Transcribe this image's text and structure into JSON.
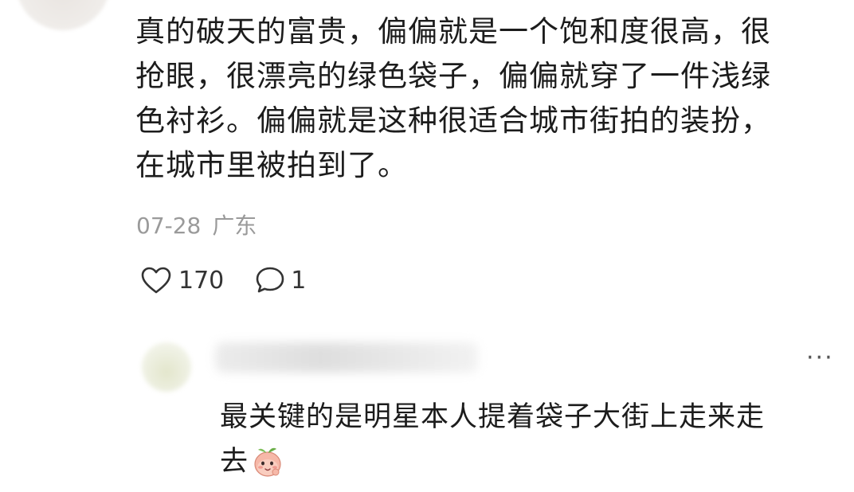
{
  "comment": {
    "lines": [
      "真的破天的富贵，偏偏就是一个饱和度很高，很",
      "抢眼，很漂亮的绿色袋子，偏偏就穿了一件浅绿",
      "色衬衫。偏偏就是这种很适合城市街拍的装扮，",
      "在城市里被拍到了。"
    ],
    "date": "07-28",
    "location": "广东",
    "like_count": "170",
    "reply_count": "1"
  },
  "reply": {
    "lines": [
      "最关键的是明星本人提着袋子大街上走来走",
      "去"
    ],
    "more_label": "···",
    "emoji_name": "peach-face-emoji"
  },
  "icons": {
    "like": "heart-outline-icon",
    "reply": "chat-bubble-icon"
  },
  "colors": {
    "text": "#1c1c1c",
    "meta": "#9a9a9a"
  }
}
